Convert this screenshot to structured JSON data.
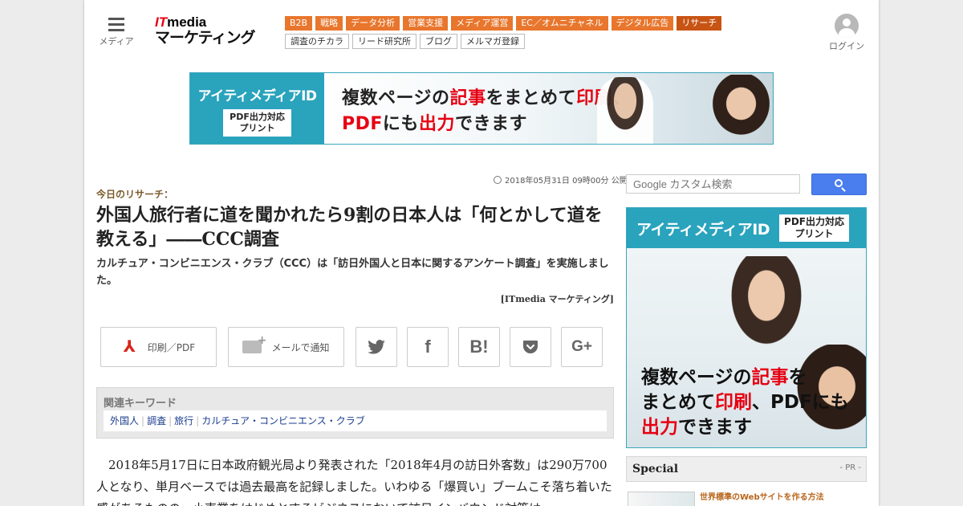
{
  "header": {
    "menu_label": "メディア",
    "logo_top": "ITmedia",
    "logo_bottom": "マーケティング",
    "login_label": "ログイン"
  },
  "nav_primary": [
    "B2B",
    "戦略",
    "データ分析",
    "営業支援",
    "メディア運営",
    "EC／オムニチャネル",
    "デジタル広告",
    "リサーチ"
  ],
  "nav_primary_active": "リサーチ",
  "nav_secondary": [
    "調査のチカラ",
    "リード研究所",
    "ブログ",
    "メルマガ登録"
  ],
  "banner": {
    "brand": "アイティメディアID",
    "badge_line1": "PDF出力対応",
    "badge_line2": "プリント",
    "copy_line1_a": "複数ページの",
    "copy_line1_b": "記事",
    "copy_line1_c": "をまとめて",
    "copy_line1_d": "印刷",
    "copy_line1_e": "、",
    "copy_line2_a": "PDF",
    "copy_line2_b": "にも",
    "copy_line2_c": "出力",
    "copy_line2_d": "できます"
  },
  "article": {
    "published": "2018年05月31日 09時00分 公開",
    "kicker": "今日のリサーチ：",
    "title": "外国人旅行者に道を聞かれたら9割の日本人は「何とかして道を教える」――CCC調査",
    "subtitle": "カルチュア・コンビニエンス・クラブ（CCC）は「訪日外国人と日本に関するアンケート調査」を実施しました。",
    "byline": "[ITmedia マーケティング]",
    "body": "2018年5月17日に日本政府観光局より発表された「2018年4月の訪日外客数」は290万700人となり、単月ベースでは過去最高を記録しました。いわゆる「爆買い」ブームこそ落ち着いた感があるものの、小売業をはじめとするビジネスにおいて訪日インバウンド対策は"
  },
  "share": {
    "print_label": "印刷／PDF",
    "mail_label": "メールで通知",
    "hatena_label": "B!",
    "gplus_label": "G+"
  },
  "keywords": {
    "heading": "関連キーワード",
    "items": [
      "外国人",
      "調査",
      "旅行",
      "カルチュア・コンビニエンス・クラブ"
    ]
  },
  "sidebar": {
    "search_placeholder": "Google カスタム検索",
    "ad_brand": "アイティメディアID",
    "ad_badge_line1": "PDF出力対応",
    "ad_badge_line2": "プリント",
    "ad_copy_l1_a": "複数ページの",
    "ad_copy_l1_b": "記事",
    "ad_copy_l1_c": "を",
    "ad_copy_l2_a": "まとめて",
    "ad_copy_l2_b": "印刷",
    "ad_copy_l2_c": "、PDFにも",
    "ad_copy_l3_a": "出力",
    "ad_copy_l3_b": "できます",
    "special_heading": "Special",
    "special_pr": "- PR -",
    "special_item_title": "世界標準のWebサイトを作る方法"
  },
  "colors": {
    "nav_orange": "#e8762c",
    "nav_active": "#c85414",
    "brand_teal": "#2aa3bd",
    "highlight_red": "#e60012",
    "search_blue": "#4a7ded"
  }
}
